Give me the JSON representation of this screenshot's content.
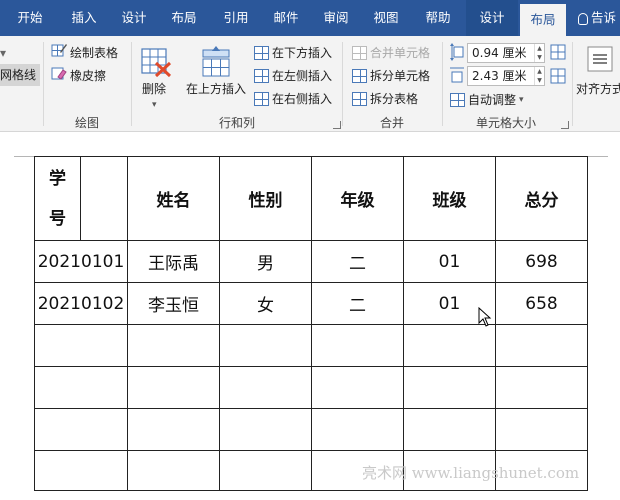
{
  "menu": {
    "tabs": [
      "开始",
      "插入",
      "设计",
      "布局",
      "引用",
      "邮件",
      "审阅",
      "视图",
      "帮助",
      "设计",
      "布局",
      "告诉"
    ],
    "tell_me_icon": "lightbulb-icon"
  },
  "ribbon": {
    "view_gridlines": "网格线",
    "draw": {
      "draw_table": "绘制表格",
      "eraser": "橡皮擦",
      "label": "绘图"
    },
    "rows_cols": {
      "delete": "删除",
      "insert_above": "在上方插入",
      "insert_below": "在下方插入",
      "insert_left": "在左侧插入",
      "insert_right": "在右侧插入",
      "label": "行和列"
    },
    "merge": {
      "merge_cells": "合并单元格",
      "split_cells": "拆分单元格",
      "split_table": "拆分表格",
      "label": "合并"
    },
    "cell_size": {
      "height": "0.94 厘米",
      "width": "2.43 厘米",
      "autofit": "自动调整",
      "label": "单元格大小"
    },
    "alignment": {
      "label": "对齐方式"
    }
  },
  "table": {
    "header_xuehao_1": "学",
    "header_xuehao_2": "号",
    "headers": [
      "姓名",
      "性别",
      "年级",
      "班级",
      "总分"
    ],
    "rows": [
      [
        "20210101",
        "王际禹",
        "男",
        "二",
        "01",
        "698"
      ],
      [
        "20210102",
        "李玉恒",
        "女",
        "二",
        "01",
        "658"
      ]
    ]
  },
  "watermark": "亮术网 www.liangshunet.com",
  "colors": {
    "menubar": "#2b579a",
    "ribbon": "#f3f3f3",
    "accent_icon": "#4a79b8",
    "delete_x": "#e04a2b"
  }
}
